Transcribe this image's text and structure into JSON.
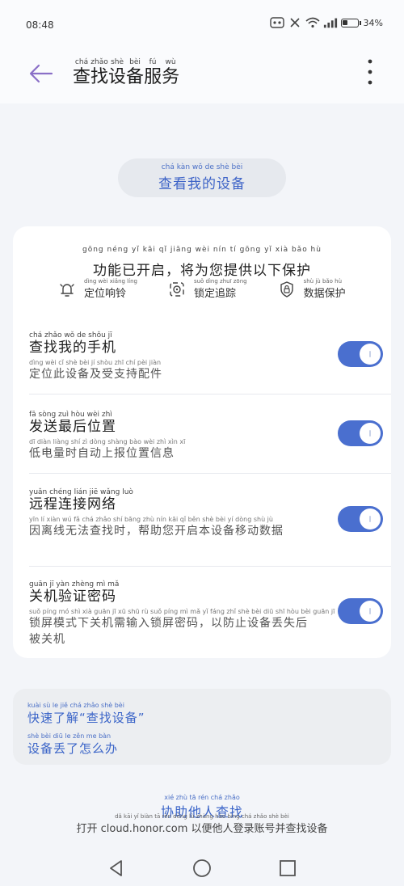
{
  "status": {
    "time": "08:48",
    "battery": "34%"
  },
  "appbar": {
    "title": [
      {
        "py": "chá",
        "hz": "查"
      },
      {
        "py": "zhǎo",
        "hz": "找"
      },
      {
        "py": "shè",
        "hz": "设"
      },
      {
        "py": "bèi",
        "hz": "备"
      },
      {
        "py": "fú",
        "hz": "服"
      },
      {
        "py": "wù",
        "hz": "务"
      }
    ]
  },
  "view_device": {
    "pinyin": "chá kàn wǒ de shè bèi",
    "label": "查看我的设备"
  },
  "card": {
    "notice_pinyin": "gōng néng yǐ kāi qǐ   jiāng wèi nín tí gōng yǐ xià bǎo hù",
    "notice": "功能已开启，将为您提供以下保护",
    "features": [
      {
        "icon": "bell-icon",
        "py": "dìng wèi xiǎng líng",
        "label": "定位响铃"
      },
      {
        "icon": "target-icon",
        "py": "suǒ dìng zhuī zōng",
        "label": "锁定追踪"
      },
      {
        "icon": "shield-lock-icon",
        "py": "shù jù bǎo hù",
        "label": "数据保护"
      }
    ],
    "settings": [
      {
        "title_py": "chá zhǎo wǒ de shǒu jī",
        "title": "查找我的手机",
        "desc_py": "dìng wèi cǐ shè bèi jí shòu zhī chí pèi jiàn",
        "desc": "定位此设备及受支持配件"
      },
      {
        "title_py": "fā sòng zuì hòu wèi zhì",
        "title": "发送最后位置",
        "desc_py": "dī diàn liàng shí zì dòng shàng bào wèi zhì xìn xī",
        "desc": "低电量时自动上报位置信息"
      },
      {
        "title_py": "yuǎn chéng lián jiē wǎng luò",
        "title": "远程连接网络",
        "desc_py": "yīn lí xiàn wú fǎ chá zhǎo shí   bāng zhù nín kāi qǐ běn shè bèi yí dòng shù jù",
        "desc": "因离线无法查找时，帮助您开启本设备移动数据"
      },
      {
        "title_py": "guān jī yàn zhèng mì mǎ",
        "title": "关机验证密码",
        "desc_py": "suǒ píng mó shì xià guān jī xū shū rù suǒ píng mì mǎ   yǐ fáng zhǐ shè bèi diū shī hòu bèi guān jī",
        "desc": "锁屏模式下关机需输入锁屏密码，以防止设备丢失后被关机"
      }
    ]
  },
  "help": [
    {
      "py": "kuài sù le jiě   chá zhǎo shè bèi",
      "label": "快速了解“查找设备”"
    },
    {
      "py": "shè bèi diū le zěn me bàn",
      "label": "设备丢了怎么办"
    }
  ],
  "assist": {
    "py": "xié zhù tā rén chá zhǎo",
    "label": "协助他人查找",
    "desc_py": "dǎ kāi                 yǐ biàn tā rén dēng lù zhàng hào bìng chá zhǎo shè bèi",
    "desc": "打开 cloud.honor.com 以便他人登录账号并查找设备"
  },
  "colors": {
    "accent": "#3a64c8",
    "toggle_on": "#4a6fcf"
  }
}
